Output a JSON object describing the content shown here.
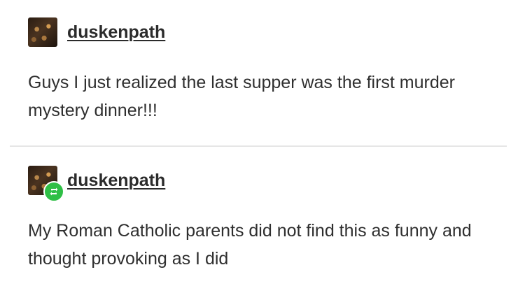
{
  "posts": [
    {
      "username": "duskenpath",
      "avatar_icon": "avatar-candlelit-icon",
      "text": "Guys I just realized the last supper was the first murder mystery dinner!!!"
    },
    {
      "username": "duskenpath",
      "avatar_icon": "avatar-candlelit-icon",
      "badge_icon": "reblog-icon",
      "badge_color": "#2fbf46",
      "text": "My Roman Catholic parents did not find this as funny and thought provoking as I did"
    }
  ]
}
